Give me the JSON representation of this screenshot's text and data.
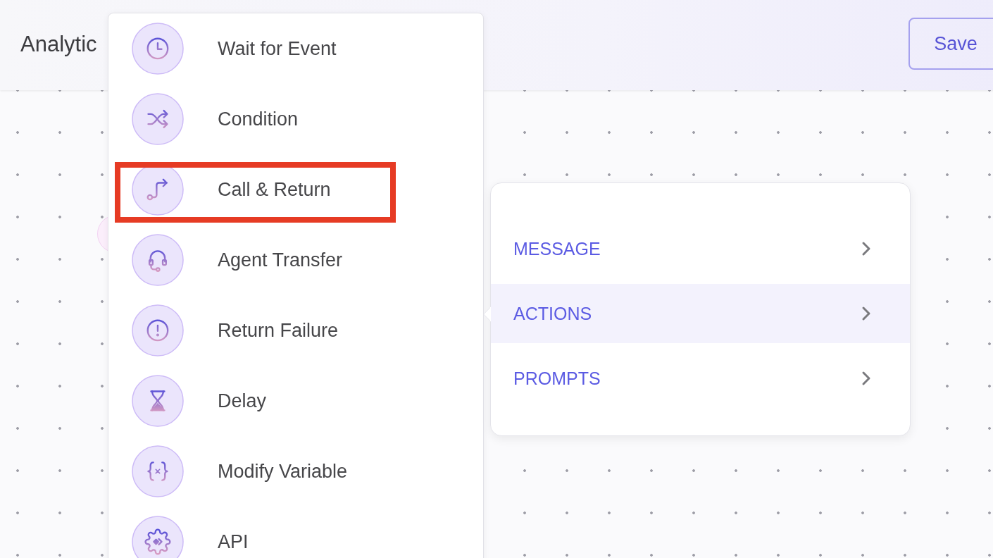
{
  "header": {
    "title": "Analytic",
    "save_button": "Save"
  },
  "action_menu": {
    "items": [
      {
        "label": "Wait for Event",
        "highlighted": false
      },
      {
        "label": "Condition",
        "highlighted": false
      },
      {
        "label": "Call & Return",
        "highlighted": true
      },
      {
        "label": "Agent Transfer",
        "highlighted": false
      },
      {
        "label": "Return Failure",
        "highlighted": false
      },
      {
        "label": "Delay",
        "highlighted": false
      },
      {
        "label": "Modify Variable",
        "highlighted": false
      },
      {
        "label": "API",
        "highlighted": false
      }
    ]
  },
  "category_menu": {
    "items": [
      {
        "label": "MESSAGE",
        "selected": false
      },
      {
        "label": "ACTIONS",
        "selected": true
      },
      {
        "label": "PROMPTS",
        "selected": false
      }
    ]
  }
}
